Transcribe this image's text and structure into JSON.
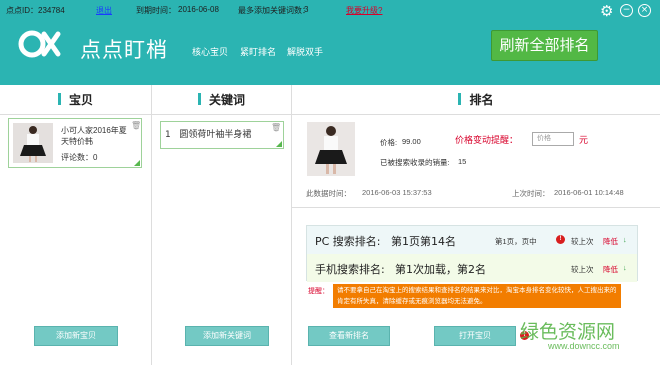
{
  "topbar": {
    "user_id_label": "点点ID：234784",
    "logout": "退出",
    "expire_label": "到期时间：",
    "expire_value": "2016-06-08",
    "max_kw_label": "最多添加关键词数：",
    "max_kw_value": "3",
    "upgrade": "我要升级?"
  },
  "app": {
    "title": "点点盯梢",
    "nav": [
      "核心宝贝",
      "紧盯排名",
      "解脱双手"
    ],
    "refresh_button": "刷新全部排名",
    "colors": {
      "header": "#2bb4b2",
      "refresh": "#52b845",
      "accent_red": "#d8002a",
      "tip": "#f27d00"
    }
  },
  "columns": {
    "baobei_title": "宝贝",
    "kw_title": "关键词",
    "rank_title": "排名"
  },
  "baobei": {
    "item_title": "小可人家2016年夏天特价韩",
    "item_comments": "评论数：0",
    "add_button": "添加新宝贝"
  },
  "keyword": {
    "index": "1",
    "text": "圆领荷叶袖半身裙",
    "add_button": "添加新关键词"
  },
  "rank": {
    "price_label": "价格:",
    "price_value": "99.00",
    "sales_label": "已被搜索收录的销量:",
    "sales_value": "15",
    "alert_label": "价格变动提醒：",
    "price_placeholder": "价格",
    "yuan": "元",
    "this_refresh_label": "此数据时间：",
    "this_refresh_value": "2016-06-03 15:37:53",
    "last_label": "上次时间：",
    "last_value": "2016-06-01 10:14:48",
    "pc_label": "PC  搜索排名:",
    "pc_value": "第1页第14名",
    "pc_pos": "第1页，页中",
    "mobile_label": "手机搜索排名:",
    "mobile_value": "第1次加载，第2名",
    "compare_label": "较上次",
    "pc_trend": "降低",
    "mobile_trend": "降低",
    "tip_label": "提醒：",
    "tip_text": "请不要拿自己在淘宝上的搜索结果和查排名的结果来对比，淘宝本身排名变化较快，人工搜出来的肯定有所失真，清除缓存或无痕浏览器均无法避免。",
    "view_button": "查看新排名",
    "open_button": "打开宝贝"
  },
  "watermark": {
    "cn": "绿色资源网",
    "url": "www.downcc.com"
  }
}
